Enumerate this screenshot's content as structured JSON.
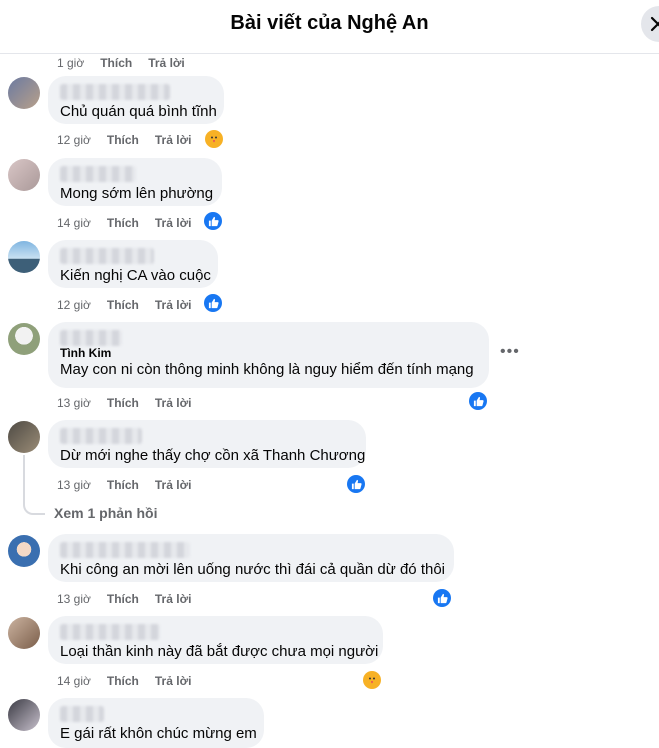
{
  "header": {
    "title": "Bài viết của Nghệ An",
    "close_icon": "close-icon"
  },
  "top_actions": {
    "time": "1 giờ",
    "like": "Thích",
    "reply": "Trả lời"
  },
  "comments": [
    {
      "text": "Chủ quán quá bình tĩnh",
      "time": "12 giờ",
      "like": "Thích",
      "reply": "Trả lời",
      "reaction": "care"
    },
    {
      "text": "Mong sớm lên phường",
      "time": "14 giờ",
      "like": "Thích",
      "reply": "Trả lời",
      "reaction": "like"
    },
    {
      "text": "Kiến nghị CA vào cuộc",
      "time": "12 giờ",
      "like": "Thích",
      "reply": "Trả lời",
      "reaction": "like"
    },
    {
      "name_visible": "Tình Kim",
      "text": "May con ni còn thông minh không là nguy hiểm đến tính mạng",
      "time": "13 giờ",
      "like": "Thích",
      "reply": "Trả lời",
      "reaction": "like"
    },
    {
      "text": "Dừ mới nghe thấy chợ cồn xã Thanh Chương",
      "time": "13 giờ",
      "like": "Thích",
      "reply": "Trả lời",
      "reaction": "like",
      "replies": "Xem 1 phản hồi"
    },
    {
      "text": "Khi công an mời lên uống nước thì đái cả quần dừ đó thôi",
      "time": "13 giờ",
      "like": "Thích",
      "reply": "Trả lời",
      "reaction": "like"
    },
    {
      "text": "Loại thần kinh này đã bắt được chưa mọi người",
      "time": "14 giờ",
      "like": "Thích",
      "reply": "Trả lời",
      "reaction": "care"
    },
    {
      "text": "E gái rất khôn chúc mừng em"
    }
  ],
  "colors": {
    "like": "#1877f2",
    "care": "#f7b125",
    "bubble": "#f0f2f5",
    "meta": "#65676b"
  }
}
